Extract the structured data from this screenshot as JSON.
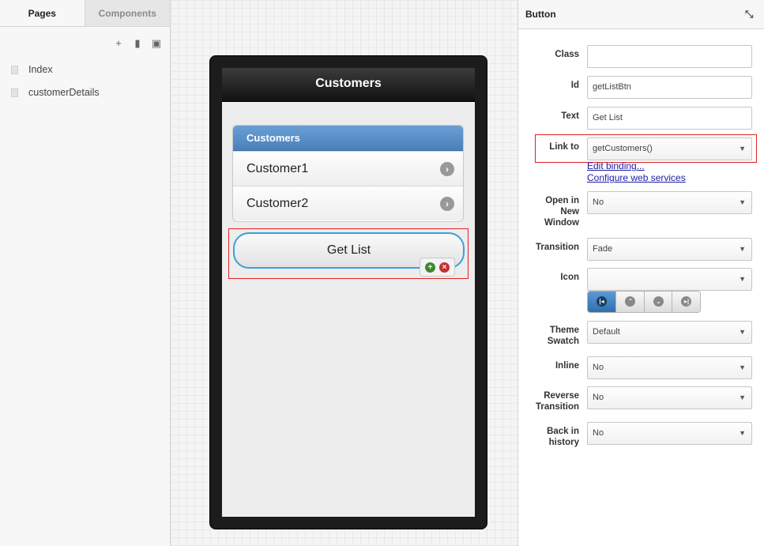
{
  "left_panel": {
    "tabs": [
      {
        "label": "Pages"
      },
      {
        "label": "Components"
      }
    ],
    "toolbar": {
      "add_icon": "plus-icon",
      "copy_icon": "copy-icon",
      "delete_icon": "trash-icon"
    },
    "pages": [
      {
        "label": "Index"
      },
      {
        "label": "customerDetails"
      }
    ]
  },
  "phone": {
    "header_title": "Customers",
    "list": {
      "header": "Customers",
      "items": [
        {
          "label": "Customer1"
        },
        {
          "label": "Customer2"
        }
      ]
    },
    "button_label": "Get List"
  },
  "properties": {
    "title": "Button",
    "fields": {
      "class": {
        "label": "Class",
        "value": ""
      },
      "id": {
        "label": "Id",
        "value": "getListBtn"
      },
      "text": {
        "label": "Text",
        "value": "Get List"
      },
      "link_to": {
        "label": "Link to",
        "value": "getCustomers()"
      },
      "open_new_window": {
        "label1": "Open in",
        "label2": "New",
        "label3": "Window",
        "value": "No"
      },
      "transition": {
        "label": "Transition",
        "value": "Fade"
      },
      "icon": {
        "label": "Icon",
        "value": ""
      },
      "theme_swatch": {
        "label1": "Theme",
        "label2": "Swatch",
        "value": "Default"
      },
      "inline": {
        "label": "Inline",
        "value": "No"
      },
      "reverse_transition": {
        "label1": "Reverse",
        "label2": "Transition",
        "value": "No"
      },
      "back_in_history": {
        "label1": "Back in",
        "label2": "history",
        "value": "No"
      }
    },
    "links": {
      "edit_binding": "Edit binding...",
      "configure_ws": "Configure web services"
    }
  },
  "colors": {
    "accent": "#4a7fb8",
    "selection": "#e02020",
    "button_border": "#3ba0d9"
  }
}
